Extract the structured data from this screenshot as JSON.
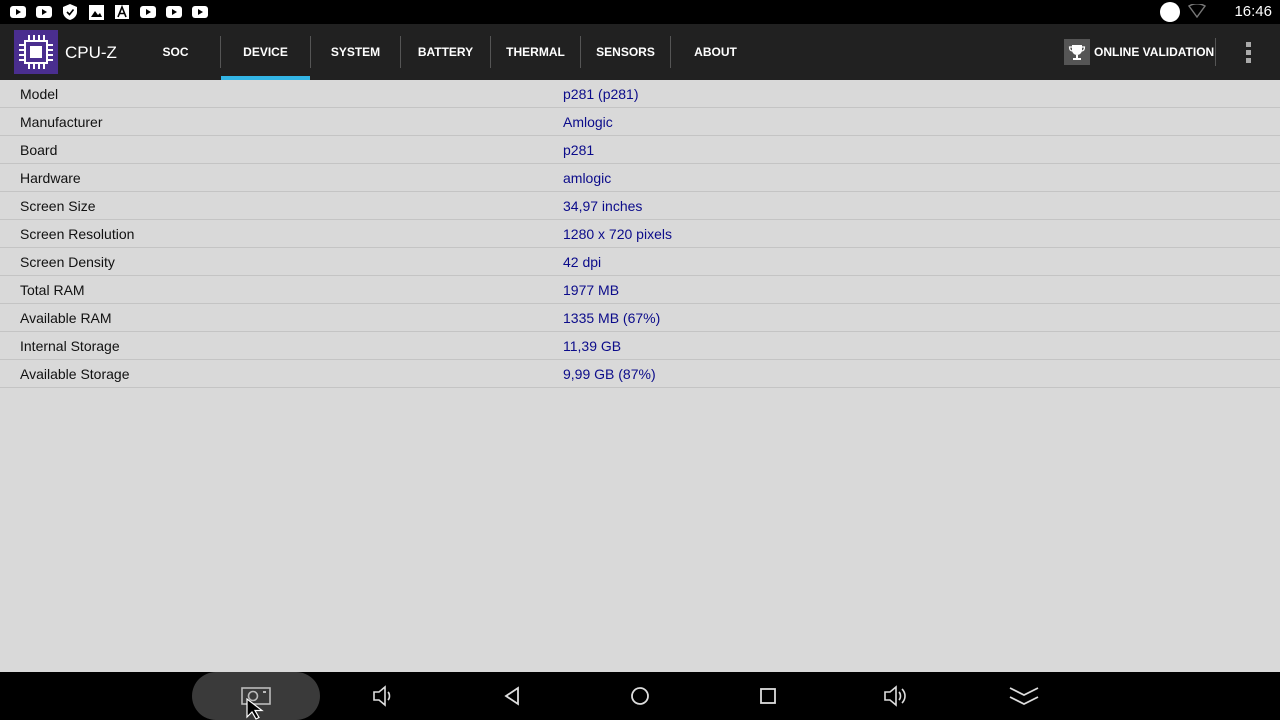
{
  "status_bar": {
    "time": "16:46",
    "notification_icons": [
      "youtube-icon",
      "youtube-icon",
      "shield-icon",
      "image-icon",
      "font-icon",
      "youtube-icon",
      "youtube-icon",
      "youtube-icon"
    ]
  },
  "app": {
    "title": "CPU-Z",
    "accent_color": "#33b5e5",
    "logo_color": "#4a2e8f"
  },
  "tabs": [
    {
      "label": "SOC",
      "active": false
    },
    {
      "label": "DEVICE",
      "active": true
    },
    {
      "label": "SYSTEM",
      "active": false
    },
    {
      "label": "BATTERY",
      "active": false
    },
    {
      "label": "THERMAL",
      "active": false
    },
    {
      "label": "SENSORS",
      "active": false
    },
    {
      "label": "ABOUT",
      "active": false
    }
  ],
  "actions": {
    "validation_label": "ONLINE VALIDATION"
  },
  "device_info": [
    {
      "label": "Model",
      "value": "p281 (p281)"
    },
    {
      "label": "Manufacturer",
      "value": "Amlogic"
    },
    {
      "label": "Board",
      "value": "p281"
    },
    {
      "label": "Hardware",
      "value": "amlogic"
    },
    {
      "label": "Screen Size",
      "value": "34,97 inches"
    },
    {
      "label": "Screen Resolution",
      "value": "1280 x 720 pixels"
    },
    {
      "label": "Screen Density",
      "value": "42 dpi"
    },
    {
      "label": "Total RAM",
      "value": "1977 MB"
    },
    {
      "label": "Available RAM",
      "value": "1335 MB  (67%)"
    },
    {
      "label": "Internal Storage",
      "value": "11,39 GB"
    },
    {
      "label": "Available Storage",
      "value": "9,99 GB (87%)"
    }
  ],
  "nav_bar": {
    "buttons": [
      "screenshot-icon",
      "volume-down-icon",
      "back-icon",
      "home-icon",
      "recents-icon",
      "volume-up-icon",
      "collapse-icon"
    ]
  }
}
